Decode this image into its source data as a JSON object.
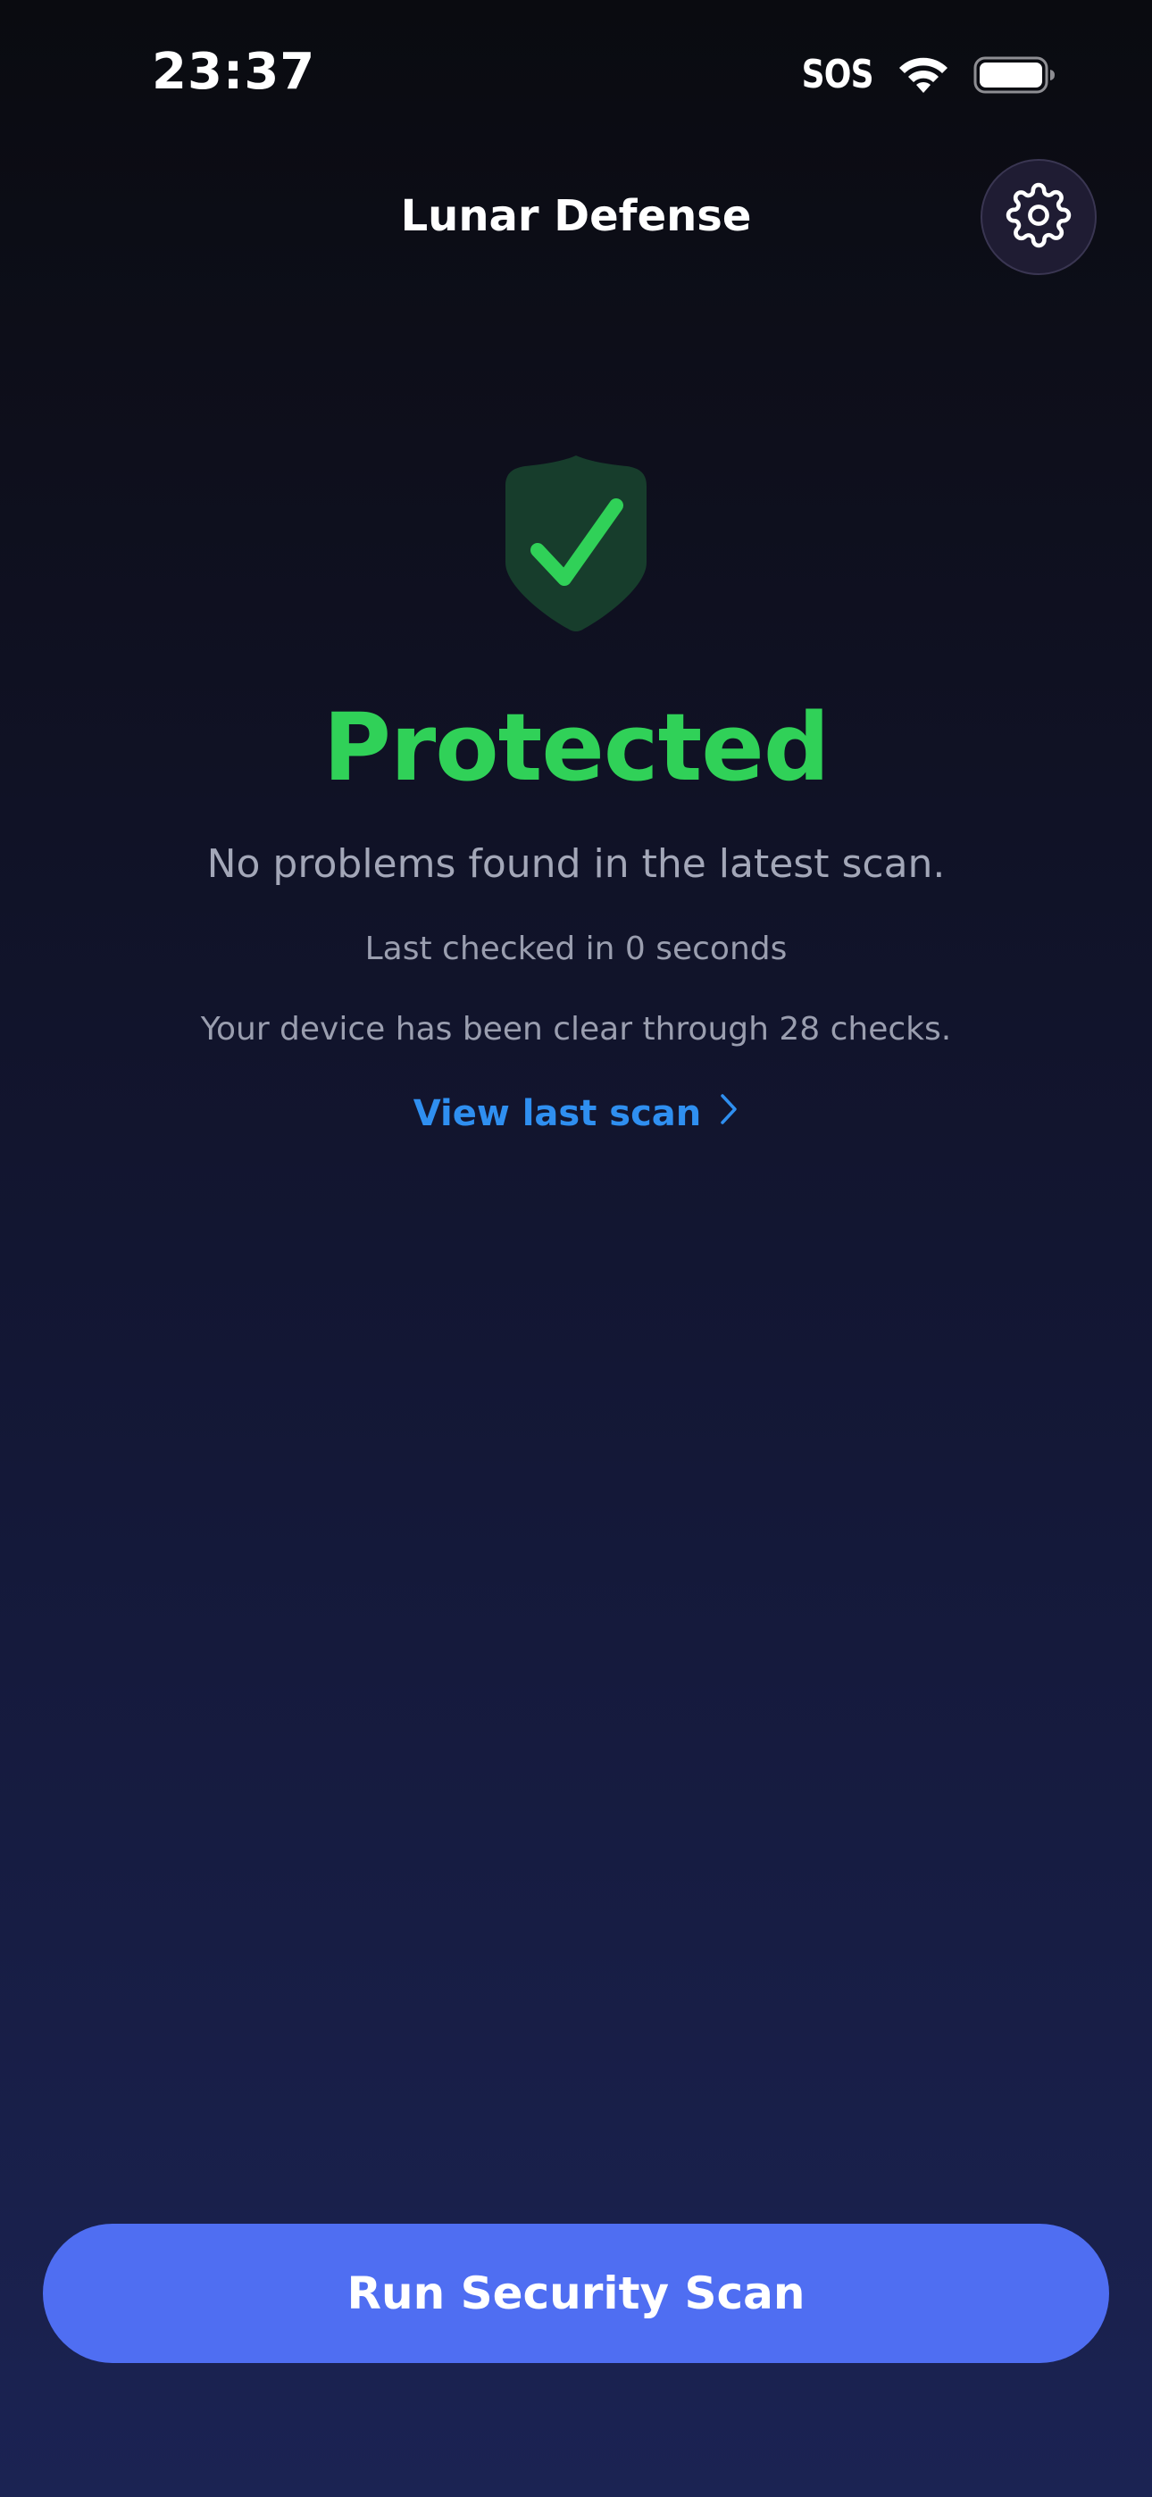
{
  "status_bar": {
    "time": "23:37",
    "carrier_status": "SOS",
    "wifi_icon": "wifi-icon",
    "battery_icon": "battery-full-icon"
  },
  "header": {
    "title": "Lunar Defense",
    "settings_icon": "gear-icon"
  },
  "status": {
    "icon": "shield-check-icon",
    "headline": "Protected",
    "subtitle": "No problems found in the latest scan.",
    "last_checked": "Last checked in 0 seconds",
    "clear_checks": "Your device has been clear through 28 checks.",
    "view_scan_label": "View last scan",
    "view_scan_icon": "chevron-right-icon"
  },
  "actions": {
    "scan_button_label": "Run Security Scan"
  },
  "colors": {
    "accent_button": "#4f6ef2",
    "protected_green": "#30d158",
    "shield_fill": "#173d2c",
    "link_blue": "#2f8ff0",
    "muted_text": "#a3a7b8"
  }
}
